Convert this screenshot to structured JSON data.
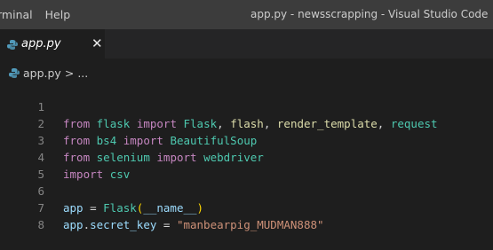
{
  "titlebar": {
    "menu": [
      "rminal",
      "Help"
    ],
    "window_title": "app.py - newsscrapping - Visual Studio Code"
  },
  "tab": {
    "label": "app.py",
    "close_glyph": "✕",
    "icon": "python-file-icon"
  },
  "breadcrumb": {
    "file": "app.py",
    "separator": ">",
    "more": "..."
  },
  "colors": {
    "keyword": "#c586c0",
    "module": "#4ec9b0",
    "function": "#dcdcaa",
    "variable": "#9cdcfe",
    "string": "#ce9178",
    "line_number": "#858585",
    "editor_bg": "#1e1e1e"
  },
  "editor": {
    "line_numbers": [
      "1",
      "2",
      "3",
      "4",
      "5",
      "6",
      "7",
      "8"
    ],
    "lines": [
      {
        "t": [
          "from",
          " ",
          "flask",
          " ",
          "import",
          " ",
          "Flask",
          ", ",
          "flash",
          ", ",
          "render_template",
          ", ",
          "request"
        ]
      },
      {
        "t": [
          "from",
          " ",
          "bs4",
          " ",
          "import",
          " ",
          "BeautifulSoup"
        ]
      },
      {
        "t": [
          "from",
          " ",
          "selenium",
          " ",
          "import",
          " ",
          "webdriver"
        ]
      },
      {
        "t": [
          "import",
          " ",
          "csv"
        ]
      },
      {
        "t": []
      },
      {
        "t": [
          "app",
          " = ",
          "Flask",
          "(",
          "__name__",
          ")"
        ]
      },
      {
        "t": [
          "app",
          ".",
          "secret_key",
          " = ",
          "\"manbearpig_MUDMAN888\""
        ]
      },
      {
        "t": []
      }
    ]
  }
}
